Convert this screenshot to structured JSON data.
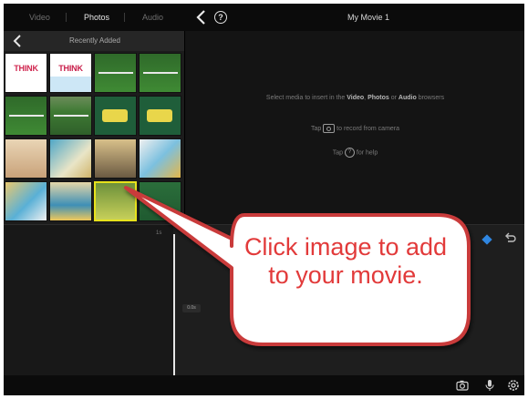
{
  "top_bar": {
    "segments": [
      {
        "label": "Video",
        "active": false
      },
      {
        "label": "Photos",
        "active": true
      },
      {
        "label": "Audio",
        "active": false
      }
    ],
    "back_icon": "chevron-left-icon",
    "help_icon": "help-icon",
    "help_glyph": "?",
    "project_title": "My Movie 1"
  },
  "browser": {
    "title": "Recently Added",
    "back_icon": "chevron-left-icon",
    "thumbnails": [
      {
        "name": "thumb-think-1",
        "label": "THINK",
        "style": "think-a"
      },
      {
        "name": "thumb-think-2",
        "label": "THINK",
        "style": "think-b"
      },
      {
        "name": "thumb-field-1",
        "style": "field"
      },
      {
        "name": "thumb-field-2",
        "style": "field"
      },
      {
        "name": "thumb-field-3",
        "style": "field"
      },
      {
        "name": "thumb-stadium-1",
        "style": "stadium"
      },
      {
        "name": "thumb-chalkboard-1",
        "style": "chalk"
      },
      {
        "name": "thumb-chalkboard-2",
        "style": "chalk"
      },
      {
        "name": "thumb-people-1",
        "style": "people"
      },
      {
        "name": "thumb-paint-1",
        "style": "paint"
      },
      {
        "name": "thumb-figures-1",
        "style": "figures"
      },
      {
        "name": "thumb-cartoon-1",
        "style": "cartoon"
      },
      {
        "name": "thumb-cartoon-2",
        "style": "cartoon2"
      },
      {
        "name": "thumb-beach-1",
        "style": "beach"
      },
      {
        "name": "thumb-selected",
        "style": "selected",
        "selected": true
      },
      {
        "name": "thumb-boardgame-1",
        "style": "board"
      }
    ]
  },
  "viewer": {
    "line1_pre": "Select media to insert in the ",
    "line1_video": "Video",
    "line1_sep1": ", ",
    "line1_photos": "Photos",
    "line1_sep2": " or ",
    "line1_audio": "Audio",
    "line1_post": " browsers",
    "line2_pre": "Tap",
    "line2_post": "to record from camera",
    "line3_pre": "Tap",
    "line3_help": "?",
    "line3_post": "for help"
  },
  "timeline": {
    "time_label": "1s",
    "marker_label": "0.0s"
  },
  "bottom_bar": {
    "icons": [
      "camera-icon",
      "microphone-icon",
      "settings-icon"
    ]
  },
  "callout": {
    "text": "Click image to add to your movie.",
    "color": "#e23a3a",
    "border_color": "#c93a3a"
  },
  "colors": {
    "accent_blue": "#2f86e0",
    "selection_yellow": "#e7e21c"
  }
}
